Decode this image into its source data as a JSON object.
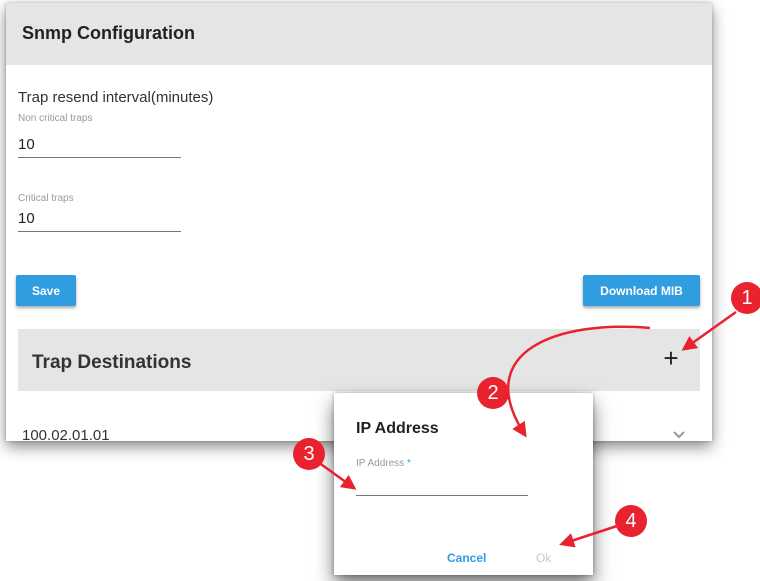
{
  "snmp": {
    "title": "Snmp Configuration",
    "section_label": "Trap resend interval(minutes)",
    "non_critical": {
      "label": "Non critical traps",
      "value": "10"
    },
    "critical": {
      "label": "Critical traps",
      "value": "10"
    },
    "save_label": "Save",
    "download_label": "Download MIB"
  },
  "trap_destinations": {
    "title": "Trap Destinations",
    "add_icon": "plus-icon",
    "rows": [
      {
        "value": "100.02.01.01"
      }
    ]
  },
  "dialog": {
    "title": "IP Address",
    "field_label": "IP Address",
    "required_mark": "*",
    "field_value": "",
    "cancel_label": "Cancel",
    "ok_label": "Ok"
  },
  "callouts": [
    "1",
    "2",
    "3",
    "4"
  ],
  "colors": {
    "accent": "#2f9de0",
    "callout": "#e8222e",
    "header_bg": "#e5e5e5"
  }
}
